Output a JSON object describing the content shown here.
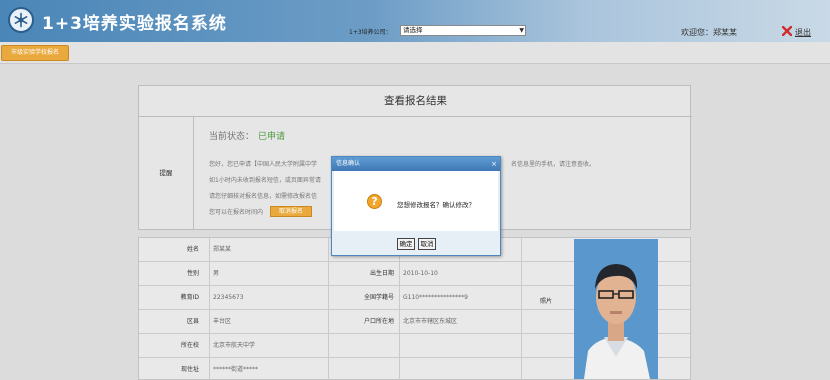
{
  "header": {
    "title": "1+3培养实验报名系统",
    "course_label": "1+3培养公司：",
    "course_selected": "请选择",
    "welcome": "欢迎您：郑某某",
    "logout": "退出"
  },
  "tab": {
    "label": "市级实验学校报名"
  },
  "result": {
    "title": "查看报名结果",
    "tip_label": "提醒",
    "status_label": "当前状态：",
    "status_value": "已申请",
    "messages": [
      "您好，您已申请【中国人民大学附属中学",
      "如1小时内未收到报名短信，或页面异常请",
      "请您仔细核对报名信息，如需修改报名信",
      "您可以在报名时间内"
    ],
    "cancel_button": "取消报名",
    "right_text": "名信息里的手机，请注意查收。"
  },
  "info": {
    "name_label": "姓名",
    "name": "郑某某",
    "gender_label": "性别",
    "gender": "男",
    "birth_label": "出生日期",
    "birth": "2010-10-10",
    "edu_id_label": "教育ID",
    "edu_id": "22345673",
    "national_id_label": "全国学籍号",
    "national_id": "G110***************9",
    "district_label": "区县",
    "district": "丰台区",
    "hukou_label": "户口所在地",
    "hukou": "北京市市辖区东城区",
    "school_label": "所在校",
    "school": "北京市航天中学",
    "address_label": "现住址",
    "address": "******街道*****",
    "photo_label": "照片"
  },
  "modal": {
    "title": "信息确认",
    "close": "×",
    "question": "您想修改报名？确认修改？",
    "ok": "确定",
    "cancel": "取消"
  },
  "colors": {
    "header": "#4a86b8",
    "accent": "#e9a93c",
    "status": "#4d9a3d"
  }
}
